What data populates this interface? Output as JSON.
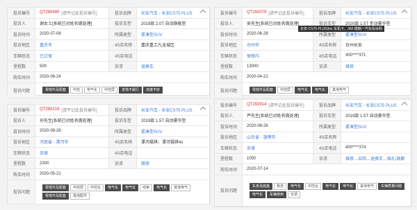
{
  "complaints": [
    {
      "id": "QT290490",
      "id_note": "[请平记此投诉编号]",
      "brand": "长安汽车 - 长安CS75 PLUS",
      "complainant": "谢女士[系统已对姓名做处理]",
      "model": "2019款 2.0T 自动旗舰型",
      "time": "2020-07-08",
      "type": "紧凑型SUV",
      "region": "重庆市",
      "store": "重庆重工九龙城区",
      "vin": "已过保",
      "phone": "",
      "mileage": "500",
      "demand": "退换车",
      "purchase_time": "2020-06-24",
      "issues": [
        "零部件及配套",
        "中控",
        "电气化",
        "中控屏",
        "逆落不履行",
        "态度不好"
      ]
    },
    {
      "id": "QT292079",
      "id_note": "[请平记此投诉编号]",
      "brand": "长安汽车 - 长安CS75 PLUS",
      "complainant": "吴先生[系统已对姓名做处理]",
      "model": "2020款 1.5T 手动豪华型",
      "time": "2020-06-28",
      "type": "紧凑型SUV",
      "region": "台州市",
      "store": "台州长安",
      "vin": "保修内",
      "phone": "400****371",
      "mileage": "13000",
      "demand": "维修",
      "purchase_time": "2020-04-21",
      "issues": [
        "零部件及配套",
        "中控屏",
        "电气化",
        "电气化",
        "其他电气"
      ],
      "popup": "长安-CS75 PLUS3ex 车机卡、360 模糊一汽车投诉网"
    },
    {
      "id": "QT290218",
      "id_note": "[请平记此投诉编号]",
      "brand": "长安汽车 - 长安CS75 PLUS",
      "complainant": "孙先生[系统已对姓名做处理]",
      "model": "2019款 1.5T 自动豪华型",
      "time": "2020-08-26",
      "type": "紧凑型SUV",
      "region": "河南省 - 漯河市",
      "store": "漯河福祺、漯河福祺4s",
      "vin": "去保",
      "phone": "",
      "mileage": "2300",
      "demand": "维修",
      "purchase_time": "2020-05-21",
      "issues": [
        "零部件及配套",
        "中控屏",
        "中控台",
        "电气化",
        "电气化",
        "线束",
        "电气化",
        "其他电气"
      ]
    },
    {
      "id": "QT292914",
      "id_note": "[请平记此投诉编号]",
      "brand": "长安汽车 - 长安CS75 PLUS",
      "complainant": "芦先生[系统已对姓名做处理]",
      "model": "2019款 1.5T 自动豪华型",
      "time": "2020-08-26",
      "type": "紧凑型SUV",
      "region": "山东省 - 淄博市",
      "store": "",
      "vin": "去保",
      "phone": "400****374",
      "mileage": "1050",
      "demand": "维修→召回→退换车→赔礼/致歉",
      "purchase_time": "2020-07-14",
      "issues": [
        "车身及底盘",
        "悬挂",
        "电气化",
        "中控台",
        "电气化",
        "电气化",
        "其他电气",
        "车辆质量问题",
        "电气化",
        "车辆使用",
        "空调"
      ]
    }
  ],
  "labels": {
    "id": "投诉编号",
    "brand": "投诉品牌",
    "complainant": "投诉人",
    "model": "投诉车型",
    "time": "投诉时间",
    "type": "所属类型",
    "region": "投诉地区",
    "store": "4S店名称",
    "vin": "车辆状态",
    "phone": "4S店电话",
    "mileage": "里程数",
    "demand": "诉求",
    "purchase_time": "购车时间",
    "issues": "投诉问题"
  },
  "extra_tags_card3": [
    "零部件及配套",
    "其他配件"
  ],
  "extra_tags_card4": [
    "车辆质量问题",
    "车辆使用"
  ]
}
